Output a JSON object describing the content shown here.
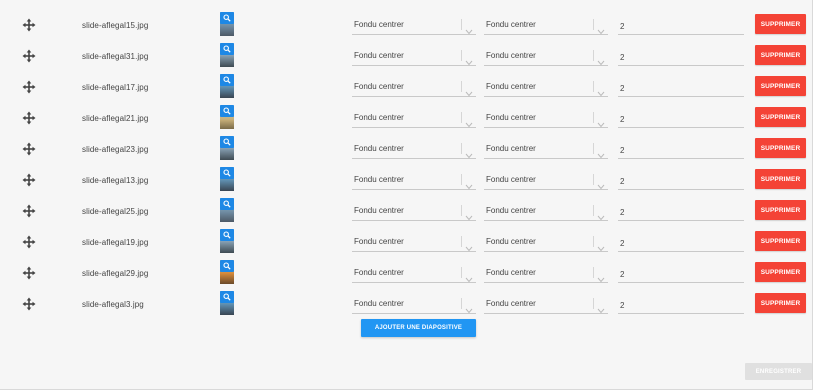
{
  "slides": [
    {
      "filename": "slide-aflegal15.jpg",
      "transition_in": "Fondu centrer",
      "transition_out": "Fondu centrer",
      "duration": "2",
      "delete_label": "SUPPRIMER",
      "thumb_style": "t1"
    },
    {
      "filename": "slide-aflegal31.jpg",
      "transition_in": "Fondu centrer",
      "transition_out": "Fondu centrer",
      "duration": "2",
      "delete_label": "SUPPRIMER",
      "thumb_style": "t2"
    },
    {
      "filename": "slide-aflegal17.jpg",
      "transition_in": "Fondu centrer",
      "transition_out": "Fondu centrer",
      "duration": "2",
      "delete_label": "SUPPRIMER",
      "thumb_style": "t4"
    },
    {
      "filename": "slide-aflegal21.jpg",
      "transition_in": "Fondu centrer",
      "transition_out": "Fondu centrer",
      "duration": "2",
      "delete_label": "SUPPRIMER",
      "thumb_style": "t3"
    },
    {
      "filename": "slide-aflegal23.jpg",
      "transition_in": "Fondu centrer",
      "transition_out": "Fondu centrer",
      "duration": "2",
      "delete_label": "SUPPRIMER",
      "thumb_style": "t2"
    },
    {
      "filename": "slide-aflegal13.jpg",
      "transition_in": "Fondu centrer",
      "transition_out": "Fondu centrer",
      "duration": "2",
      "delete_label": "SUPPRIMER",
      "thumb_style": "t4"
    },
    {
      "filename": "slide-aflegal25.jpg",
      "transition_in": "Fondu centrer",
      "transition_out": "Fondu centrer",
      "duration": "2",
      "delete_label": "SUPPRIMER",
      "thumb_style": "t1"
    },
    {
      "filename": "slide-aflegal19.jpg",
      "transition_in": "Fondu centrer",
      "transition_out": "Fondu centrer",
      "duration": "2",
      "delete_label": "SUPPRIMER",
      "thumb_style": "t2"
    },
    {
      "filename": "slide-aflegal29.jpg",
      "transition_in": "Fondu centrer",
      "transition_out": "Fondu centrer",
      "duration": "2",
      "delete_label": "SUPPRIMER",
      "thumb_style": "t5"
    },
    {
      "filename": "slide-aflegal3.jpg",
      "transition_in": "Fondu centrer",
      "transition_out": "Fondu centrer",
      "duration": "2",
      "delete_label": "SUPPRIMER",
      "thumb_style": "t4"
    }
  ],
  "icons": {
    "drag": "move-arrows-icon",
    "zoom": "search-icon",
    "dropdown": "chevron-down-icon"
  },
  "actions": {
    "add_label": "AJOUTER UNE DIAPOSITIVE",
    "save_label": "ENREGISTRER",
    "save_disabled": true
  },
  "colors": {
    "delete": "#f44336",
    "add": "#2196f3",
    "zoom": "#1e88e5",
    "save_disabled": "#e0e0e0"
  }
}
